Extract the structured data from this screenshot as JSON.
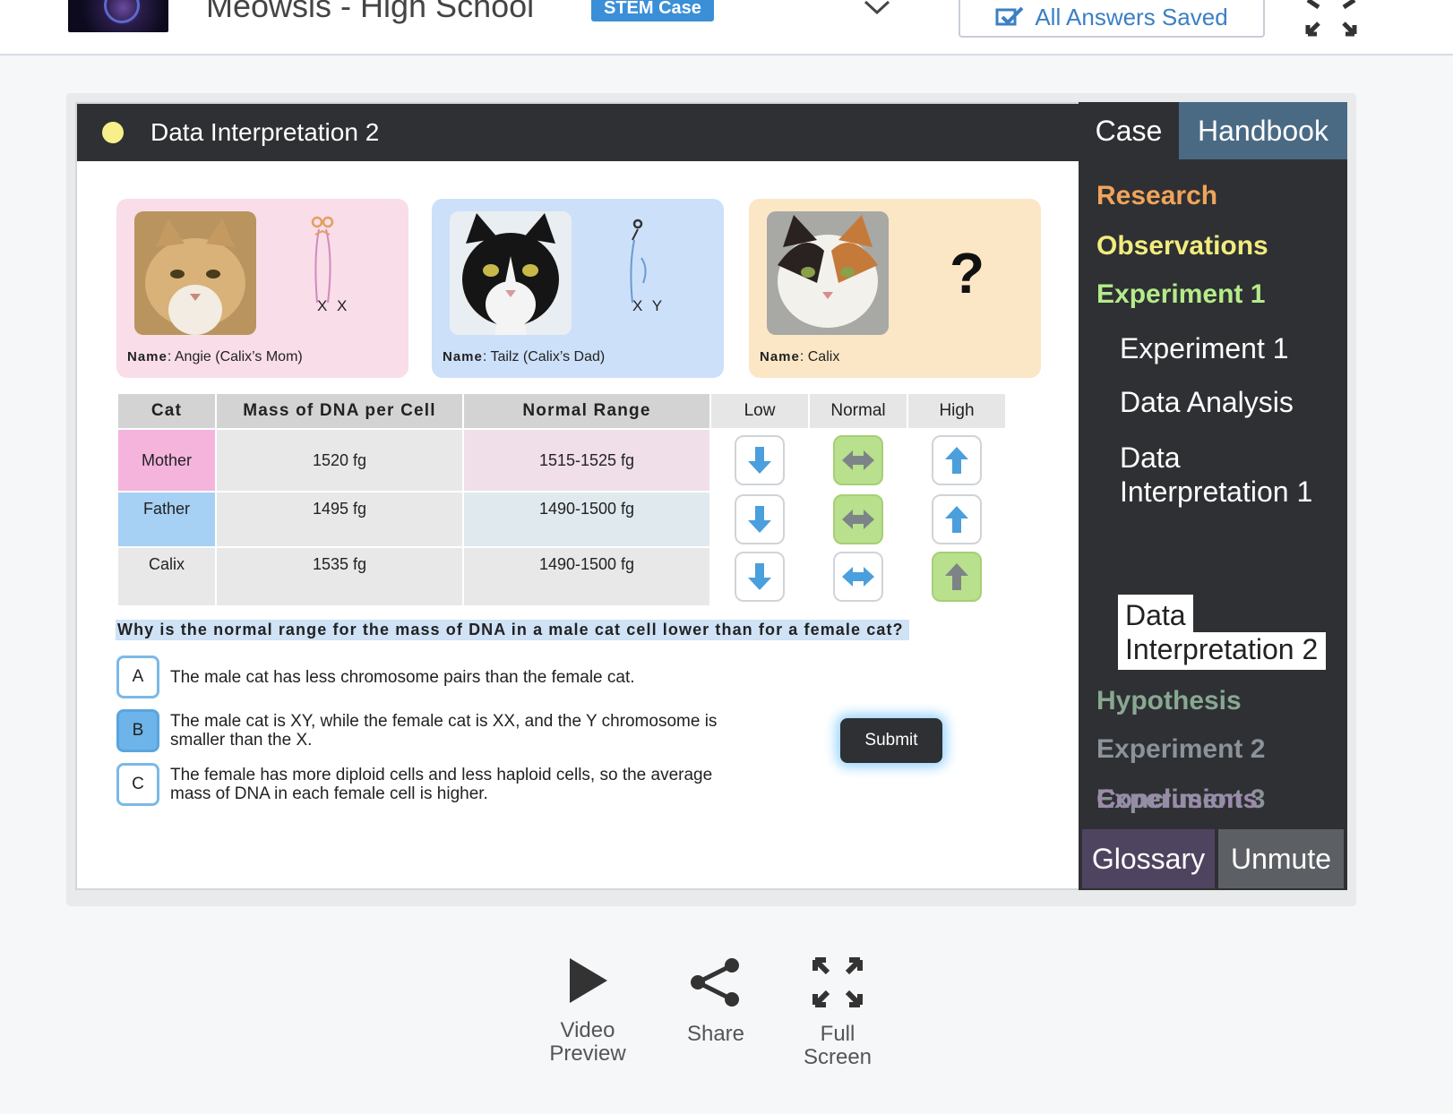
{
  "header": {
    "title": "Meowsis - High School",
    "badge": "STEM Case",
    "saved_label": "All Answers Saved"
  },
  "panel": {
    "title": "Data Interpretation 2"
  },
  "cats": [
    {
      "name_label": "Name",
      "name": "Angie (Calix’s Mom)",
      "chromosomes": "X X"
    },
    {
      "name_label": "Name",
      "name": "Tailz (Calix’s Dad)",
      "chromosomes": "X Y"
    },
    {
      "name_label": "Name",
      "name": "Calix",
      "chromosomes": "?"
    }
  ],
  "table": {
    "headers": [
      "Cat",
      "Mass of DNA per Cell",
      "Normal Range",
      "Low",
      "Normal",
      "High"
    ],
    "rows": [
      {
        "cat": "Mother",
        "mass": "1520 fg",
        "range": "1515-1525 fg",
        "selected": "normal"
      },
      {
        "cat": "Father",
        "mass": "1495 fg",
        "range": "1490-1500 fg",
        "selected": "normal"
      },
      {
        "cat": "Calix",
        "mass": "1535 fg",
        "range": "1490-1500 fg",
        "selected": "high"
      }
    ]
  },
  "question": {
    "text": "Why is the normal range for the mass of DNA in a male cat cell lower than for a female cat?",
    "options": [
      {
        "letter": "A",
        "text": "The male cat has less chromosome pairs than the female cat."
      },
      {
        "letter": "B",
        "text": "The male cat is XY, while the female cat is XX, and the Y chromosome is smaller than the X."
      },
      {
        "letter": "C",
        "text": "The female has more diploid cells and less haploid cells, so the average mass of DNA in each female cell is higher."
      }
    ],
    "selected": "B",
    "submit_label": "Submit"
  },
  "sidebar": {
    "tabs": [
      "Case",
      "Handbook"
    ],
    "sections": [
      {
        "label": "Research",
        "color": "#f0a45a"
      },
      {
        "label": "Observations",
        "color": "#f2ec7e"
      },
      {
        "label": "Experiment 1",
        "color": "#b4ec8a"
      }
    ],
    "subitems": [
      "Experiment 1",
      "Data Analysis",
      "Data Interpretation 1"
    ],
    "active_sub": {
      "line1": "Data",
      "line2": "Interpretation 2"
    },
    "later_sections": [
      {
        "label": "Hypothesis",
        "color": "#88a892"
      },
      {
        "label": "Experiment 2",
        "color": "#8a929a"
      },
      {
        "label": "Experiment 3",
        "color": "#8a929a"
      },
      {
        "label": "Conclusions",
        "color": "#9c8aac"
      }
    ],
    "footer": [
      "Glossary",
      "Unmute"
    ]
  },
  "actions": [
    {
      "label": "Video\nPreview",
      "icon": "play-icon"
    },
    {
      "label": "Share",
      "icon": "share-icon"
    },
    {
      "label": "Full\nScreen",
      "icon": "fullscreen-icon"
    }
  ],
  "colors": {
    "accent": "#3b8fd6",
    "mother_row": "#f4b4dc",
    "father_row": "#a6d0f4",
    "mom_card": "#f9dde8",
    "dad_card": "#cde0fa",
    "calix_card": "#fbe7c6"
  }
}
